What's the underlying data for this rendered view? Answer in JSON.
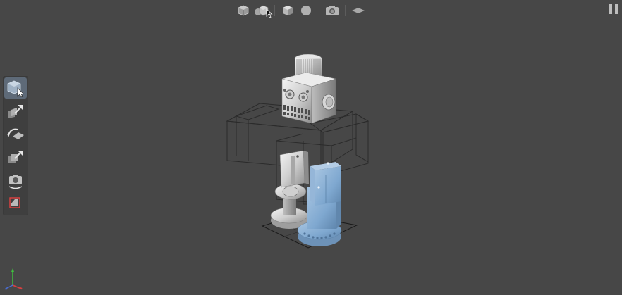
{
  "app": {
    "accent_color": "#7fa8d0",
    "background_color": "#474747"
  },
  "top_toolbar": {
    "buttons": [
      {
        "name": "single-object-view",
        "icon": "cube-icon"
      },
      {
        "name": "multi-object-view",
        "icon": "shapes-icon"
      },
      {
        "name": "solid-view",
        "icon": "cube-solid-icon"
      },
      {
        "name": "sphere-view",
        "icon": "sphere-icon"
      },
      {
        "name": "screenshot",
        "icon": "camera-icon"
      },
      {
        "name": "ground-plane",
        "icon": "plane-icon"
      }
    ]
  },
  "left_toolbar": {
    "tools": [
      {
        "name": "select",
        "icon": "select-cube-icon",
        "active": true
      },
      {
        "name": "move",
        "icon": "move-arrow-icon",
        "active": false
      },
      {
        "name": "rotate",
        "icon": "rotate-icon",
        "active": false
      },
      {
        "name": "scale",
        "icon": "scale-arrow-icon",
        "active": false
      },
      {
        "name": "camera",
        "icon": "orbit-camera-icon",
        "active": false
      },
      {
        "name": "section",
        "icon": "section-plane-icon",
        "active": false
      }
    ]
  },
  "scene": {
    "objects": [
      "robot-head",
      "robot-left-leg",
      "robot-right-leg-selected"
    ],
    "selection_color": "#7fa8d0"
  }
}
